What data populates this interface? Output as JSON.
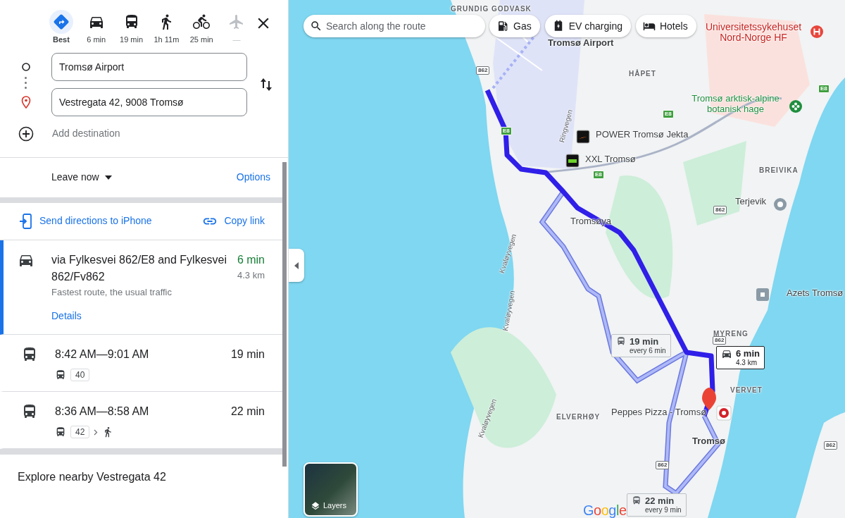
{
  "travel_modes": [
    {
      "kind": "best",
      "label": "Best",
      "selected": true,
      "disabled": false
    },
    {
      "kind": "car",
      "label": "6 min",
      "selected": false,
      "disabled": false
    },
    {
      "kind": "transit",
      "label": "19 min",
      "selected": false,
      "disabled": false
    },
    {
      "kind": "walk",
      "label": "1h 11m",
      "selected": false,
      "disabled": false
    },
    {
      "kind": "bike",
      "label": "25 min",
      "selected": false,
      "disabled": false
    },
    {
      "kind": "flight",
      "label": "—",
      "selected": false,
      "disabled": true
    }
  ],
  "origin": {
    "value": "Tromsø Airport"
  },
  "destination": {
    "value": "Vestregata 42, 9008 Tromsø"
  },
  "add_destination": {
    "placeholder": "Add destination"
  },
  "departure": {
    "label": "Leave now"
  },
  "options_link": "Options",
  "actions": [
    {
      "kind": "send",
      "label": "Send directions to iPhone"
    },
    {
      "kind": "link",
      "label": "Copy link"
    }
  ],
  "routes": [
    {
      "kind": "drive",
      "selected": true,
      "title": "via Fylkesvei 862/E8 and Fylkesvei 862/Fv862",
      "duration": "6 min",
      "distance": "4.3 km",
      "note": "Fastest route, the usual traffic",
      "details": "Details"
    },
    {
      "kind": "transit",
      "selected": false,
      "title": "8:42 AM—9:01 AM",
      "duration": "19 min",
      "steps": [
        {
          "kind": "bus",
          "line": "40"
        }
      ]
    },
    {
      "kind": "transit",
      "selected": false,
      "title": "8:36 AM—8:58 AM",
      "duration": "22 min",
      "steps": [
        {
          "kind": "bus",
          "line": "42"
        },
        {
          "kind": "walk"
        }
      ]
    }
  ],
  "explore": "Explore nearby Vestregata 42",
  "map": {
    "search": {
      "placeholder": "Search along the route"
    },
    "chips": [
      {
        "kind": "gas",
        "label": "Gas"
      },
      {
        "kind": "ev",
        "label": "EV charging"
      },
      {
        "kind": "hotel",
        "label": "Hotels"
      }
    ],
    "labels": [
      {
        "kind": "area",
        "text": "GRUNDIG GODVASK"
      },
      {
        "kind": "airport",
        "text": "Tromsø Airport"
      },
      {
        "kind": "hospital",
        "text": "Universitetssykehuset Nord-Norge HF"
      },
      {
        "kind": "area",
        "text": "HÅPET"
      },
      {
        "kind": "road",
        "text": "Ringvegen"
      },
      {
        "kind": "garden",
        "text": "Tromsø arktisk-alpine botanisk hage"
      },
      {
        "kind": "shop",
        "text": "POWER Tromsø Jekta"
      },
      {
        "kind": "shop",
        "text": "XXL Tromsø"
      },
      {
        "kind": "area",
        "text": "BREIVIKA"
      },
      {
        "kind": "landmark",
        "text": "Terjevik"
      },
      {
        "kind": "place",
        "text": "Tromsøya"
      },
      {
        "kind": "road",
        "text": "Kvaløyvegen"
      },
      {
        "kind": "road",
        "text": "Kvaløyvegen"
      },
      {
        "kind": "road",
        "text": "Kvaløyvegen"
      },
      {
        "kind": "business",
        "text": "Azets Tromsø"
      },
      {
        "kind": "area",
        "text": "MYRENG"
      },
      {
        "kind": "area",
        "text": "VERVET"
      },
      {
        "kind": "area",
        "text": "ELVERHØY"
      },
      {
        "kind": "restaurant",
        "text": "Peppes Pizza - Tromsø"
      },
      {
        "kind": "town",
        "text": "Tromsø"
      }
    ],
    "shields": [
      {
        "kind": "county",
        "text": "862"
      },
      {
        "kind": "european",
        "text": "E8"
      },
      {
        "kind": "european",
        "text": "E8"
      },
      {
        "kind": "european",
        "text": "E8"
      },
      {
        "kind": "european",
        "text": "E8"
      },
      {
        "kind": "county",
        "text": "862"
      },
      {
        "kind": "county",
        "text": "862"
      },
      {
        "kind": "county",
        "text": "862"
      },
      {
        "kind": "county",
        "text": "862"
      }
    ],
    "callouts": [
      {
        "kind": "transit",
        "selected": false,
        "duration": "19 min",
        "detail": "every 6 min"
      },
      {
        "kind": "drive",
        "selected": true,
        "duration": "6 min",
        "detail": "4.3 km"
      },
      {
        "kind": "transit",
        "selected": false,
        "duration": "22 min",
        "detail": "every 9 min"
      }
    ],
    "layers": "Layers",
    "logo": "Google"
  }
}
